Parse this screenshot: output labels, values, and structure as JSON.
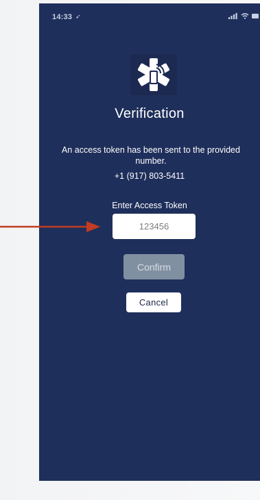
{
  "status_bar": {
    "time": "14:33",
    "location_icon": "location-arrow-icon",
    "signal_icon": "cellular-signal-icon",
    "wifi_icon": "wifi-icon",
    "battery_icon": "battery-icon"
  },
  "screen": {
    "logo_icon": "medical-star-phone-icon",
    "title": "Verification",
    "message": "An access token has been sent to the provided number.",
    "phone_number": "+1 (917) 803-5411",
    "token_label": "Enter Access Token",
    "token_value": "123456",
    "confirm_label": "Confirm",
    "cancel_label": "Cancel"
  },
  "annotation": {
    "arrow_icon": "red-arrow-icon",
    "arrow_color": "#c23b22"
  },
  "colors": {
    "background": "#1f2f5b",
    "disabled_button": "#8190a1",
    "text": "#ffffff"
  }
}
